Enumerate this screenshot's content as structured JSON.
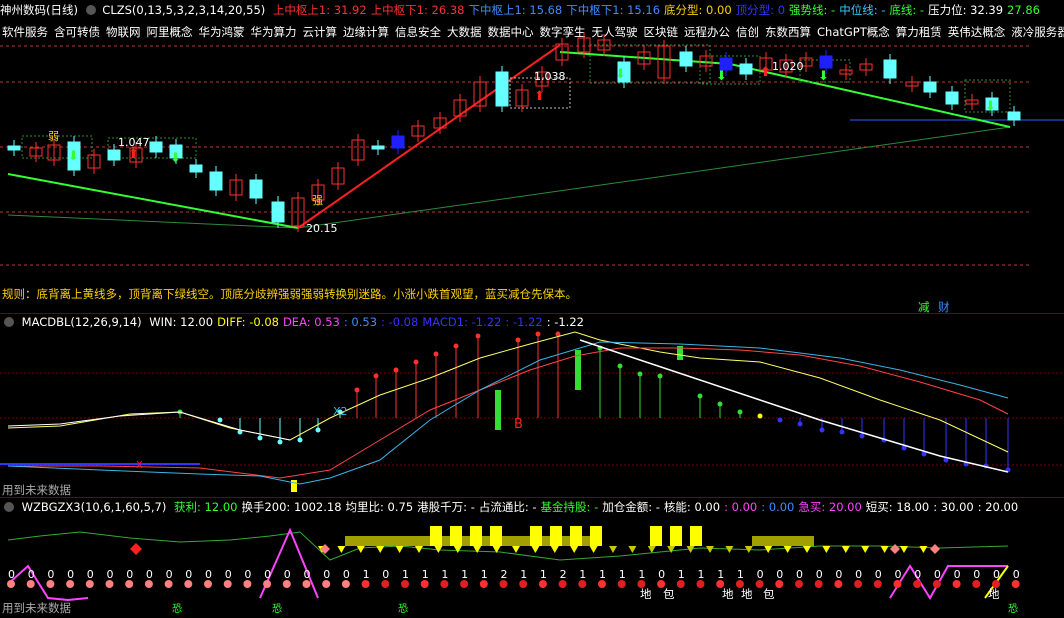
{
  "main": {
    "title": "神州数码(日线)",
    "indicator": "CLZS(0,13,5,3,2,3,14,20,55)",
    "values": [
      {
        "label": "上中枢上1: 31.92",
        "color": "#ff3030"
      },
      {
        "label": "上中枢下1: 26.38",
        "color": "#ff3030"
      },
      {
        "label": "下中枢上1: 15.68",
        "color": "#3c8cff"
      },
      {
        "label": "下中枢下1: 15.16",
        "color": "#3c8cff"
      },
      {
        "label": "底分型: 0.00",
        "color": "#ffd200"
      },
      {
        "label": "顶分型: 0",
        "color": "#3333ff"
      },
      {
        "label": "强势线: -",
        "color": "#33ff33"
      },
      {
        "label": "中位线: -",
        "color": "#33ccff"
      },
      {
        "label": "底线: -",
        "color": "#33ff33"
      },
      {
        "label": "压力位: 32.39",
        "color": "#ffffff"
      },
      {
        "label": "27.86",
        "color": "#33ff33"
      }
    ],
    "concepts": [
      "软件服务",
      "含可转债",
      "物联网",
      "阿里概念",
      "华为鸿蒙",
      "华为算力",
      "云计算",
      "边缘计算",
      "信息安全",
      "大数据",
      "数据中心",
      "数字孪生",
      "无人驾驶",
      "区块链",
      "远程办公",
      "信创",
      "东数西算",
      "ChatGPT概念",
      "算力租赁",
      "英伟达概念",
      "液冷服务器"
    ],
    "price_labels": {
      "low": "20.15",
      "high1": "1.038",
      "high2": "1.020",
      "mid1": "1.047"
    },
    "markers": {
      "weak": "弱",
      "strong": "强"
    },
    "rule_text": "规则：底背离上黄线多，顶背离下绿线空。顶底分歧辨强弱强弱转换别迷路。小涨小跌首观望，蓝买减仓先保本。",
    "bottom_tags": {
      "reduce": "减",
      "wealth": "财"
    }
  },
  "macd": {
    "title": "MACDBL(12,26,9,14)",
    "values": [
      {
        "label": "WIN: 12.00",
        "color": "#ffffff"
      },
      {
        "label": "DIFF: -0.08",
        "color": "#ffff00"
      },
      {
        "label": "DEA: 0.53",
        "color": "#ff44ff"
      },
      {
        "label": ": 0.53",
        "color": "#3c8cff"
      },
      {
        "label": ": -0.08",
        "color": "#3333ff"
      },
      {
        "label": "MACD1: -1.22",
        "color": "#3333ff"
      },
      {
        "label": ": -1.22",
        "color": "#3333ff"
      },
      {
        "label": ": -1.22",
        "color": "#ffffff"
      }
    ],
    "label_x2": "X2",
    "label_b": "B",
    "label_x": "X",
    "footer": "用到未来数据"
  },
  "wz": {
    "title": "WZBGZX3(10,6,1,60,5,7)",
    "values": [
      {
        "label": "获利: 12.00",
        "color": "#33ff33"
      },
      {
        "label": "换手200: 1002.18",
        "color": "#ffffff"
      },
      {
        "label": "均里比: 0.75",
        "color": "#ffffff"
      },
      {
        "label": "港股千万: -",
        "color": "#ffffff"
      },
      {
        "label": "占流通比: -",
        "color": "#ffffff"
      },
      {
        "label": "基金持股: -",
        "color": "#33ff33"
      },
      {
        "label": "加仓金额: -",
        "color": "#ffffff"
      },
      {
        "label": "核能: 0.00",
        "color": "#ffffff"
      },
      {
        "label": ": 0.00",
        "color": "#ff44ff"
      },
      {
        "label": ": 0.00",
        "color": "#3c8cff"
      },
      {
        "label": "急买: 20.00",
        "color": "#ff44ff"
      },
      {
        "label": "短买: 18.00",
        "color": "#ffffff"
      },
      {
        "label": ": 30.00",
        "color": "#ffffff"
      },
      {
        "label": ": 20.00",
        "color": "#ffffff"
      }
    ],
    "digits": [
      "0",
      "0",
      "0",
      "0",
      "0",
      "0",
      "0",
      "0",
      "0",
      "0",
      "0",
      "0",
      "0",
      "0",
      "0",
      "0",
      "0",
      "0",
      "1",
      "0",
      "1",
      "1",
      "1",
      "1",
      "1",
      "2",
      "1",
      "1",
      "2",
      "1",
      "1",
      "1",
      "1",
      "0",
      "1",
      "1",
      "1",
      "1",
      "0",
      "0",
      "0",
      "0",
      "0",
      "0",
      "0",
      "0",
      "0",
      "0",
      "0",
      "0",
      "0",
      "0"
    ],
    "bottom_labels": [
      "地",
      "包",
      "地",
      "地",
      "包",
      "地"
    ],
    "kong": "恐",
    "footer": "用到未来数据"
  }
}
